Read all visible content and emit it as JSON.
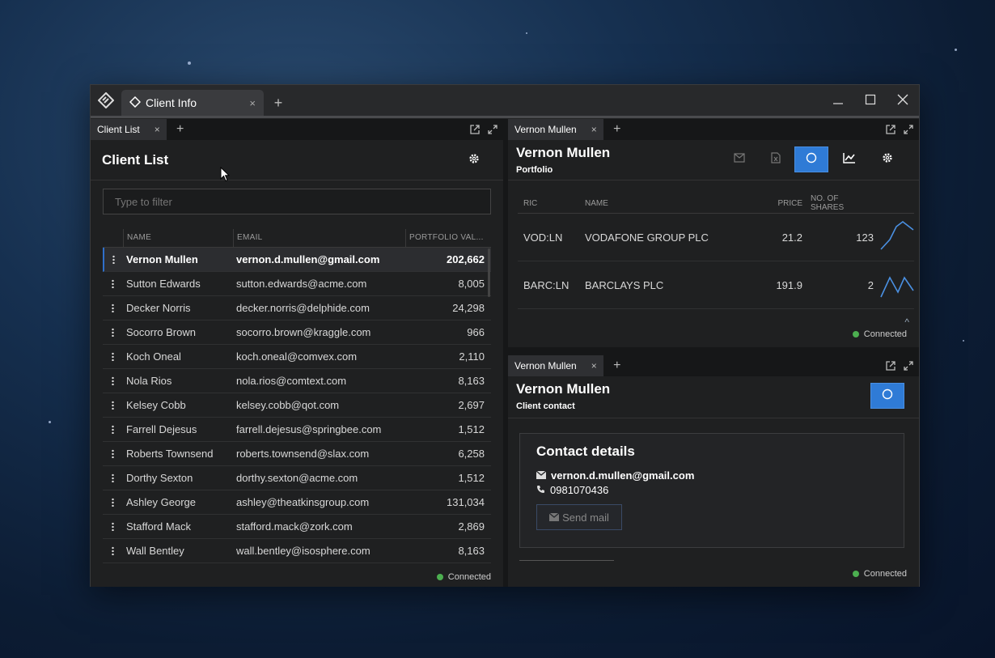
{
  "app": {
    "tab_title": "Client Info",
    "tab_close": "×",
    "tab_add": "+"
  },
  "client_list": {
    "pane_tab": "Client List",
    "pane_close": "×",
    "pane_add": "+",
    "title": "Client List",
    "filter_placeholder": "Type to filter",
    "columns": {
      "name": "NAME",
      "email": "EMAIL",
      "value": "PORTFOLIO VAL..."
    },
    "rows": [
      {
        "name": "Vernon Mullen",
        "email": "vernon.d.mullen@gmail.com",
        "value": "202,662"
      },
      {
        "name": "Sutton Edwards",
        "email": "sutton.edwards@acme.com",
        "value": "8,005"
      },
      {
        "name": "Decker Norris",
        "email": "decker.norris@delphide.com",
        "value": "24,298"
      },
      {
        "name": "Socorro Brown",
        "email": "socorro.brown@kraggle.com",
        "value": "966"
      },
      {
        "name": "Koch Oneal",
        "email": "koch.oneal@comvex.com",
        "value": "2,110"
      },
      {
        "name": "Nola Rios",
        "email": "nola.rios@comtext.com",
        "value": "8,163"
      },
      {
        "name": "Kelsey Cobb",
        "email": "kelsey.cobb@qot.com",
        "value": "2,697"
      },
      {
        "name": "Farrell Dejesus",
        "email": "farrell.dejesus@springbee.com",
        "value": "1,512"
      },
      {
        "name": "Roberts Townsend",
        "email": "roberts.townsend@slax.com",
        "value": "6,258"
      },
      {
        "name": "Dorthy Sexton",
        "email": "dorthy.sexton@acme.com",
        "value": "1,512"
      },
      {
        "name": "Ashley George",
        "email": "ashley@theatkinsgroup.com",
        "value": "131,034"
      },
      {
        "name": "Stafford Mack",
        "email": "stafford.mack@zork.com",
        "value": "2,869"
      },
      {
        "name": "Wall Bentley",
        "email": "wall.bentley@isosphere.com",
        "value": "8,163"
      }
    ],
    "status": "Connected"
  },
  "portfolio": {
    "pane_tab": "Vernon Mullen",
    "pane_close": "×",
    "pane_add": "+",
    "name": "Vernon Mullen",
    "subtitle": "Portfolio",
    "columns": {
      "ric": "RIC",
      "name": "NAME",
      "price": "PRICE",
      "shares": "NO. OF SHARES"
    },
    "rows": [
      {
        "ric": "VOD:LN",
        "name": "VODAFONE GROUP PLC",
        "price": "21.2",
        "shares": "123"
      },
      {
        "ric": "BARC:LN",
        "name": "BARCLAYS PLC",
        "price": "191.9",
        "shares": "2"
      }
    ],
    "collapse_glyph": "^",
    "status": "Connected"
  },
  "contact": {
    "pane_tab": "Vernon Mullen",
    "pane_close": "×",
    "pane_add": "+",
    "name": "Vernon Mullen",
    "subtitle": "Client contact",
    "card_title": "Contact details",
    "email": "vernon.d.mullen@gmail.com",
    "phone": "0981070436",
    "send_label": "Send mail",
    "status": "Connected"
  },
  "colors": {
    "accent": "#2f7bd6",
    "status_ok": "#4caf50"
  }
}
